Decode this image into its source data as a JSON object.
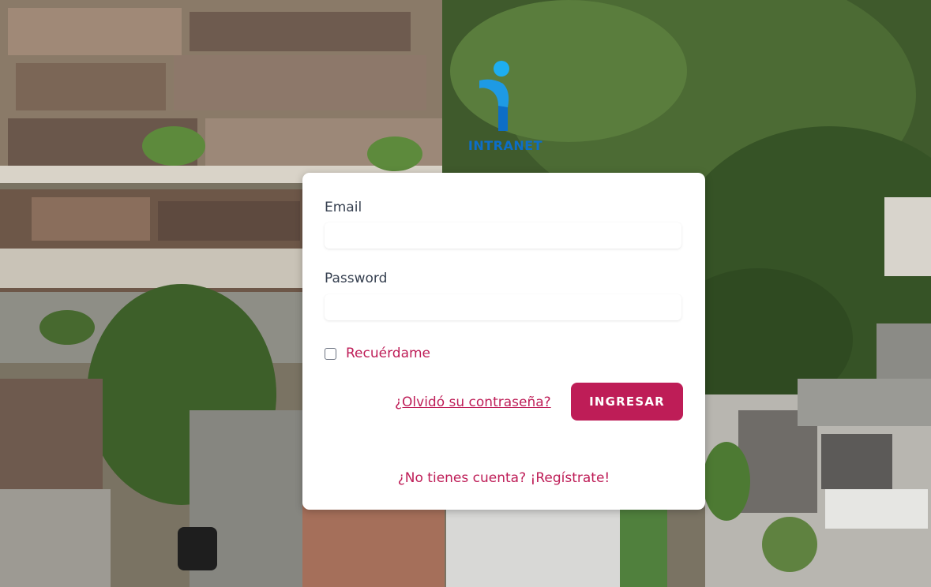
{
  "logo": {
    "text": "INTRANET",
    "icon": "intranet-i-icon",
    "color": "#0d6ec7",
    "accent": "#1eaef0"
  },
  "form": {
    "email_label": "Email",
    "email_value": "",
    "password_label": "Password",
    "password_value": "",
    "remember_label": "Recuérdame",
    "remember_checked": false,
    "forgot_link": "¿Olvidó su contraseña?",
    "submit_label": "INGRESAR",
    "register_link": "¿No tienes cuenta? ¡Regístrate!"
  },
  "colors": {
    "accent": "#be1d57",
    "label": "#374151",
    "card": "#ffffff"
  }
}
